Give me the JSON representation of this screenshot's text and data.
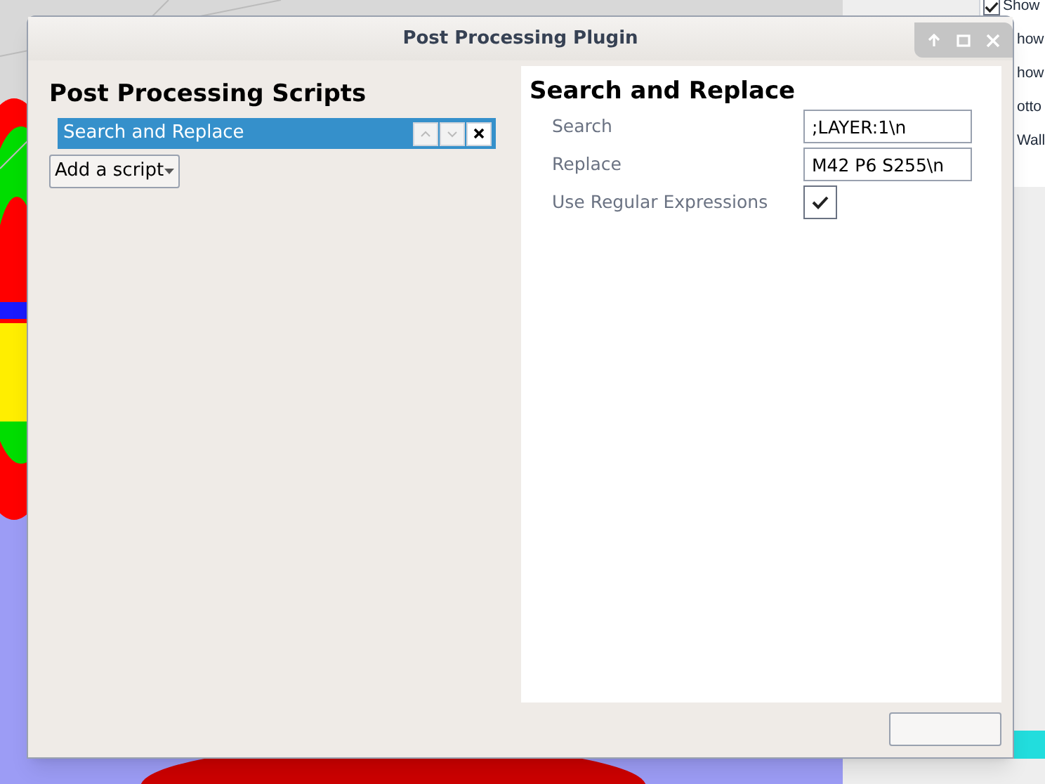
{
  "background_panel": {
    "items": [
      {
        "kind": "checkbox",
        "label": "Show",
        "checked": true
      },
      {
        "kind": "text",
        "label": "how"
      },
      {
        "kind": "text",
        "label": "how"
      },
      {
        "kind": "text",
        "label": "otto"
      },
      {
        "kind": "text",
        "label": "Wall"
      }
    ]
  },
  "window": {
    "title": "Post Processing Plugin"
  },
  "scripts": {
    "heading": "Post Processing Scripts",
    "items": [
      {
        "label": "Search and Replace",
        "selected": true
      }
    ],
    "add_button": "Add a script"
  },
  "settings": {
    "heading": "Search and Replace",
    "fields": [
      {
        "kind": "text",
        "label": "Search",
        "value": ";LAYER:1\\n"
      },
      {
        "kind": "text",
        "label": "Replace",
        "value": "M42 P6 S255\\n"
      },
      {
        "kind": "checkbox",
        "label": "Use Regular Expressions",
        "checked": true
      }
    ]
  }
}
